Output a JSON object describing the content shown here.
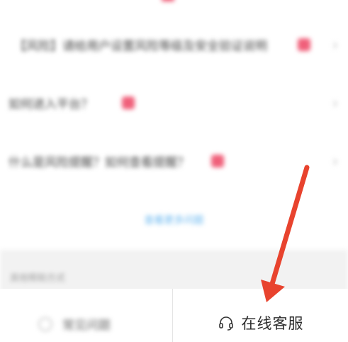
{
  "faq": {
    "items": [
      {
        "label": "【风险】请给用户设置风险等级及安全验证说明"
      },
      {
        "label": "如何进入平台？"
      },
      {
        "label": "什么是风险提醒？如何查看提醒？"
      }
    ],
    "more_link": "查看更多问题",
    "chevron": "›"
  },
  "help": {
    "section_title": "其他帮助方式"
  },
  "bottom_bar": {
    "left_button_label": "常见问题",
    "service_button_label": "在线客服",
    "service_icon": "headset-icon"
  },
  "annotation": {
    "arrow_color": "#e8432e"
  }
}
